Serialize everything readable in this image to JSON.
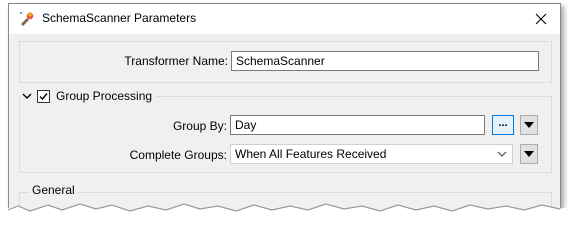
{
  "window": {
    "title": "SchemaScanner Parameters",
    "close_glyph": "✕"
  },
  "transformer": {
    "label": "Transformer Name:",
    "value": "SchemaScanner"
  },
  "group_processing": {
    "label": "Group Processing",
    "checked": true,
    "group_by": {
      "label": "Group By:",
      "value": "Day",
      "ellipsis": "..."
    },
    "complete_groups": {
      "label": "Complete Groups:",
      "value": "When All Features Received"
    }
  },
  "general": {
    "label": "General"
  },
  "colors": {
    "dialog_bg": "#f0f0f0",
    "accent": "#0078d7"
  }
}
